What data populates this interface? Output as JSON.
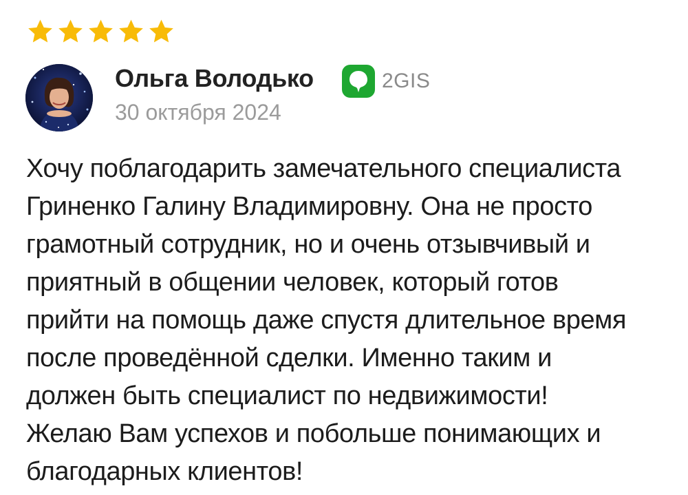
{
  "review": {
    "rating": 5,
    "rating_max": 5,
    "star_color": "#F8BB08",
    "author_name": "Ольга Володько",
    "source_name": "2GIS",
    "source_icon": "2gis-logo-icon",
    "source_color": "#1EA731",
    "date": "30 октября 2024",
    "text_lines": [
      "Хочу поблагодарить замечательного специалиста",
      "Гриненко Галину Владимировну. Она не просто",
      "грамотный сотрудник, но и очень отзывчивый и",
      "приятный в общении человек, который готов",
      "прийти на помощь даже спустя длительное время",
      "после проведённой сделки. Именно таким и",
      "должен быть специалист по недвижимости!",
      "Желаю Вам успехов и побольше понимающих и",
      "благодарных клиентов!"
    ]
  }
}
